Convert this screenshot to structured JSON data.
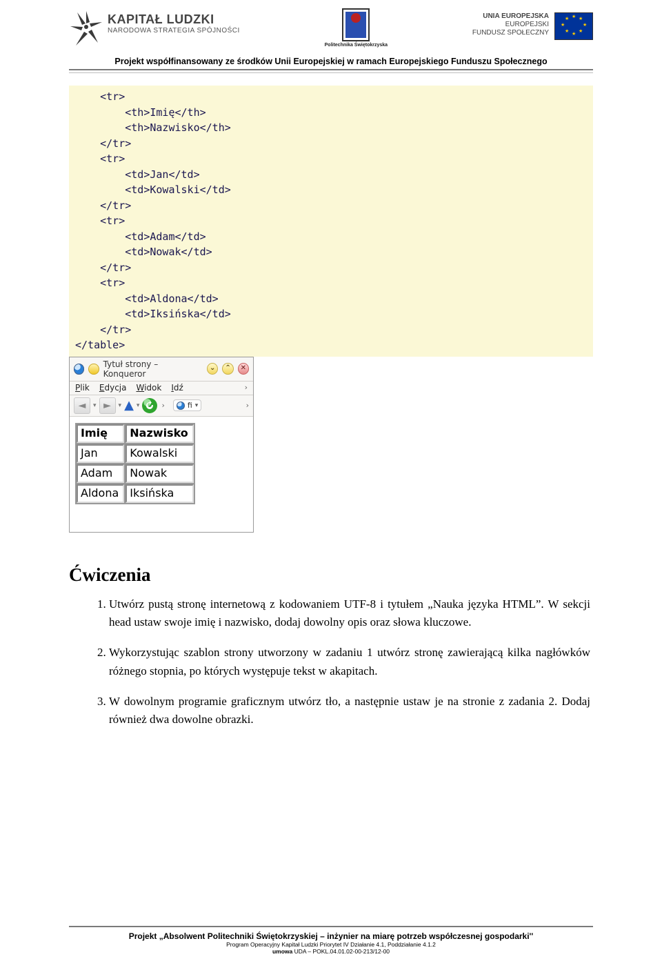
{
  "header": {
    "kl_title": "KAPITAŁ LUDZKI",
    "kl_sub": "NARODOWA STRATEGIA SPÓJNOŚCI",
    "ps_label": "Politechnika Świętokrzyska",
    "ue_line1": "UNIA EUROPEJSKA",
    "ue_line2": "EUROPEJSKI",
    "ue_line3": "FUNDUSZ SPOŁECZNY"
  },
  "funding_line": "Projekt współfinansowany ze środków Unii Europejskiej w ramach Europejskiego Funduszu Społecznego",
  "code_block": "    <tr>\n        <th>Imię</th>\n        <th>Nazwisko</th>\n    </tr>\n    <tr>\n        <td>Jan</td>\n        <td>Kowalski</td>\n    </tr>\n    <tr>\n        <td>Adam</td>\n        <td>Nowak</td>\n    </tr>\n    <tr>\n        <td>Aldona</td>\n        <td>Iksińska</td>\n    </tr>\n</table>",
  "browser": {
    "title": "Tytuł strony – Konqueror",
    "menu": {
      "file": "Plik",
      "edit": "Edycja",
      "view": "Widok",
      "go": "Idź"
    },
    "tab_label": "fi",
    "nav_min": "⌄",
    "nav_up": "⌃",
    "nav_close": "✕",
    "back": "◄",
    "fwd": "►",
    "dd": "▾",
    "up": "▲",
    "reload": "↻",
    "tab_globe": "●",
    "tab_dd": "▾",
    "chev": "›"
  },
  "chart_data": {
    "type": "table",
    "columns": [
      "Imię",
      "Nazwisko"
    ],
    "rows": [
      [
        "Jan",
        "Kowalski"
      ],
      [
        "Adam",
        "Nowak"
      ],
      [
        "Aldona",
        "Iksińska"
      ]
    ]
  },
  "table": {
    "h1": "Imię",
    "h2": "Nazwisko",
    "r1c1": "Jan",
    "r1c2": "Kowalski",
    "r2c1": "Adam",
    "r2c2": "Nowak",
    "r3c1": "Aldona",
    "r3c2": "Iksińska"
  },
  "section_title": "Ćwiczenia",
  "exercises": {
    "e1": "Utwórz pustą stronę internetową z kodowaniem UTF-8 i tytułem „Nauka języka HTML”. W sekcji head ustaw swoje imię i nazwisko, dodaj dowolny opis oraz słowa kluczowe.",
    "e2": "Wykorzystując szablon strony utworzony w zadaniu 1 utwórz stronę zawierającą kilka nagłówków różnego stopnia, po których występuje tekst w akapitach.",
    "e3": "W dowolnym programie graficznym utwórz tło, a następnie ustaw je na stronie z zadania 2. Dodaj również dwa dowolne obrazki."
  },
  "footer": {
    "l1": "Projekt „Absolwent Politechniki Świętokrzyskiej – inżynier na miarę potrzeb współczesnej gospodarki''",
    "l2": "Program Operacyjny Kapitał Ludzki Priorytet IV Działanie 4.1, Poddziałanie 4.1.2",
    "l3": "umowa  UDA – POKL.04.01.02-00-213/12-00"
  }
}
